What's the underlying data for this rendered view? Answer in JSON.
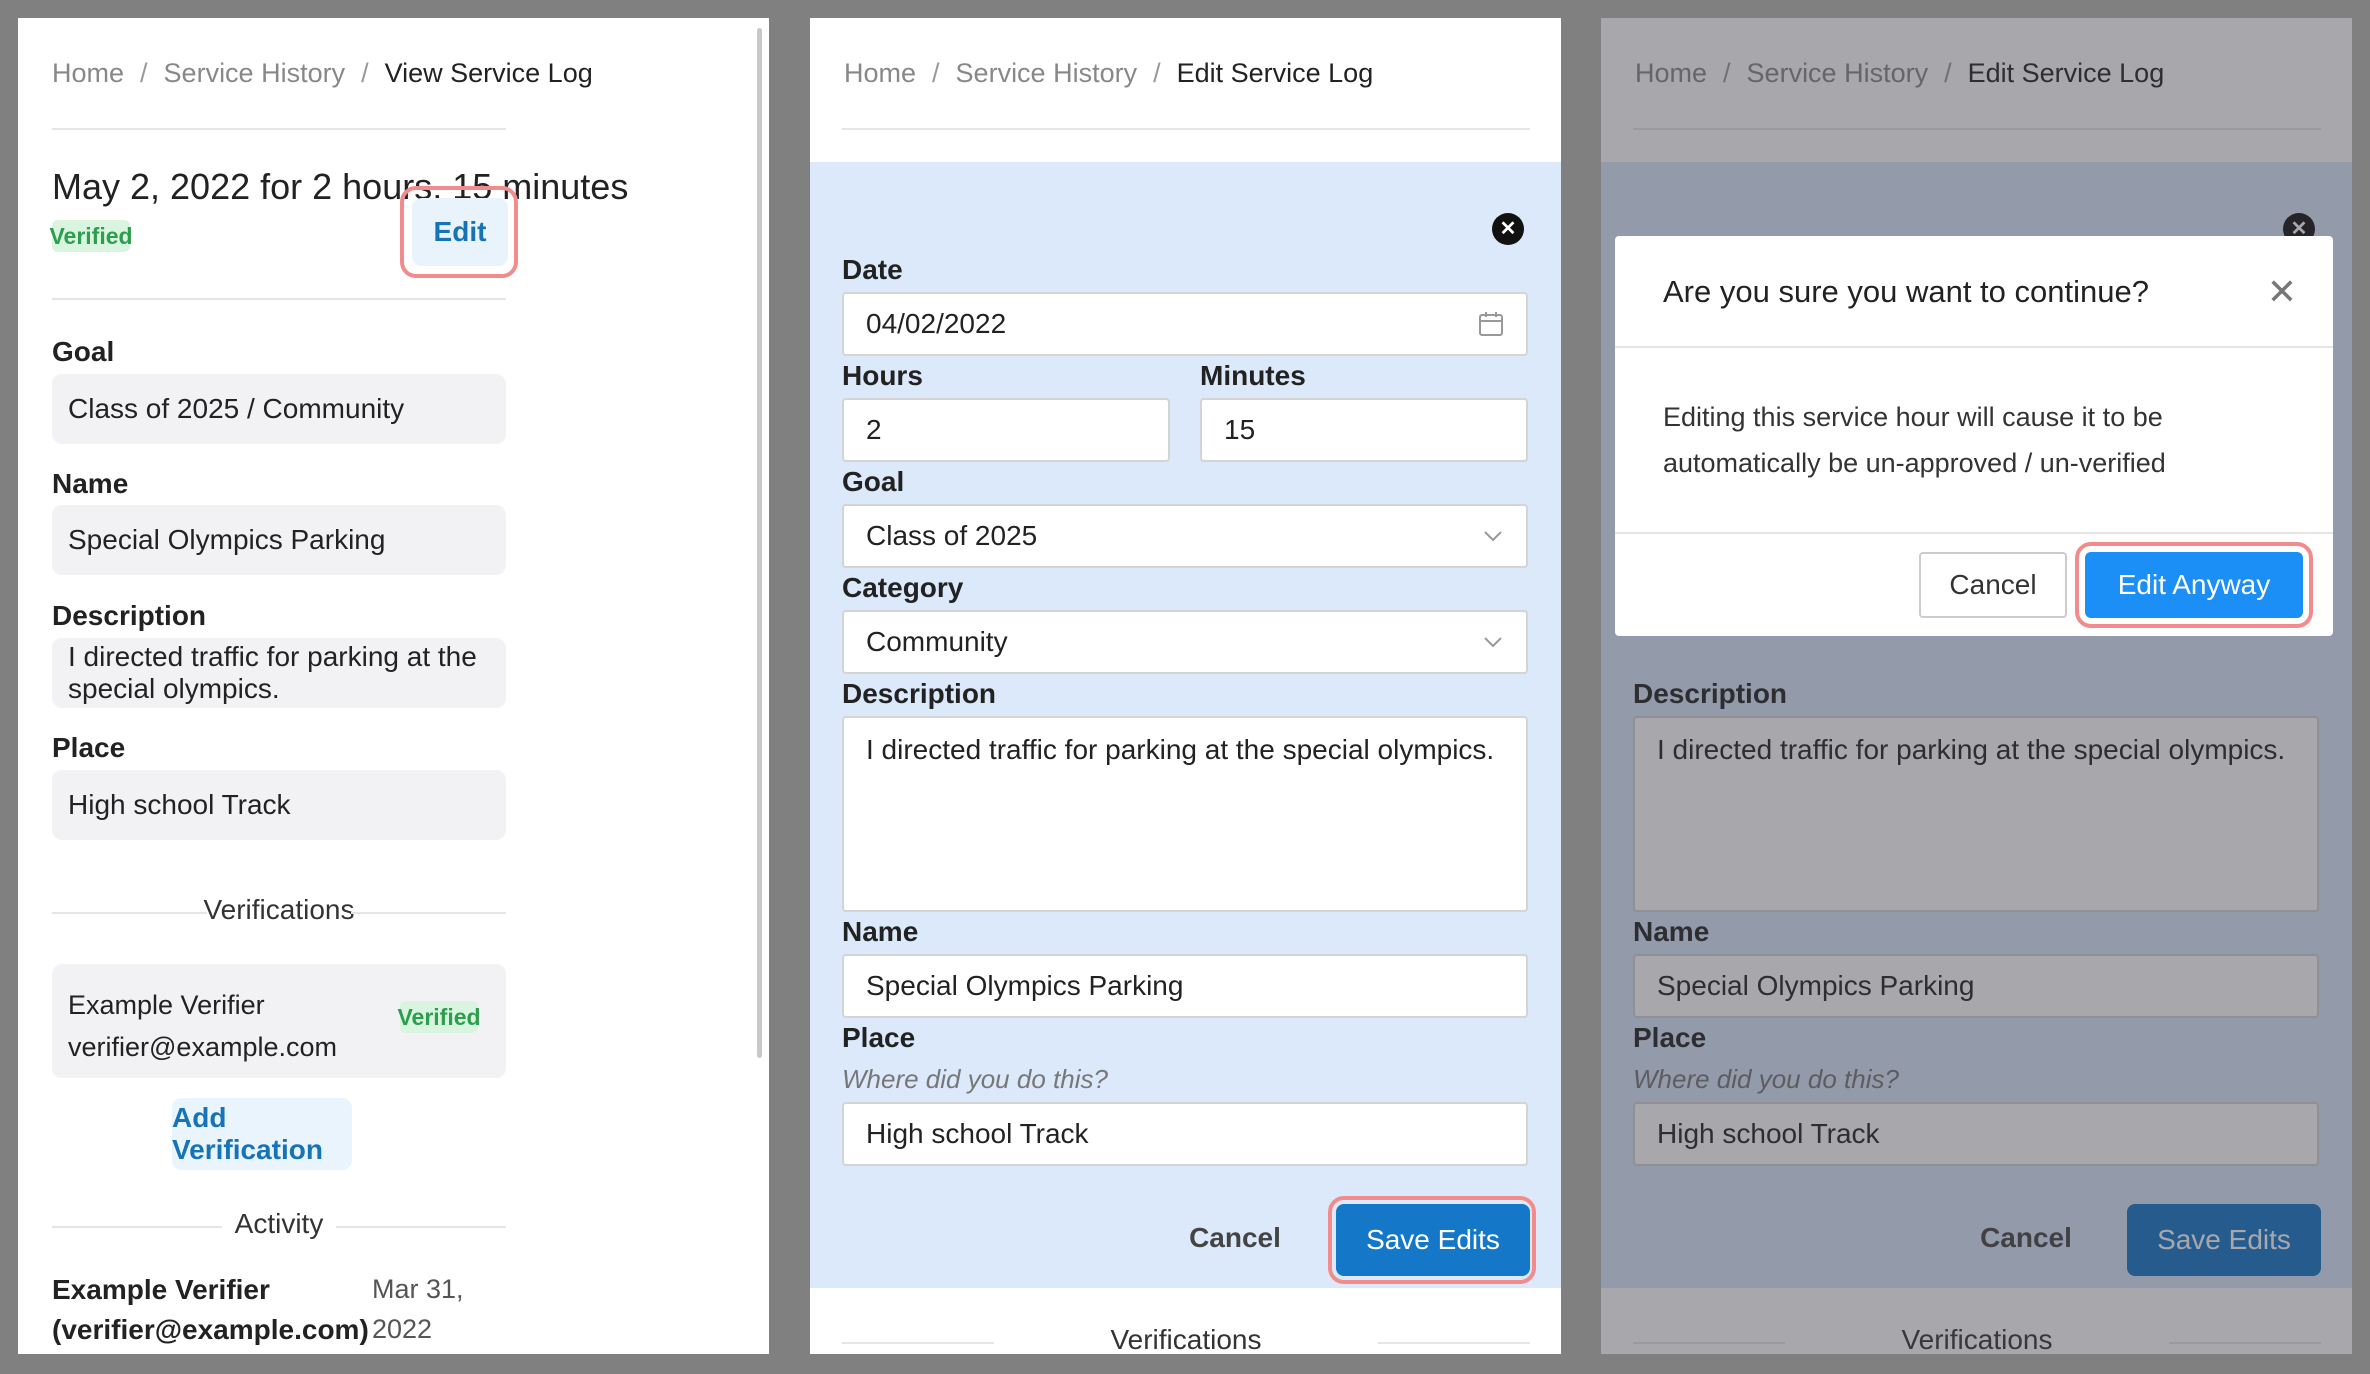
{
  "breadcrumbs": {
    "home": "Home",
    "history": "Service History",
    "view": "View Service Log",
    "edit": "Edit Service Log"
  },
  "view_log": {
    "title": "May 2, 2022 for 2 hours, 15 minutes",
    "status_badge": "Verified",
    "edit_label": "Edit",
    "goal_label": "Goal",
    "goal_value": "Class of 2025 / Community",
    "name_label": "Name",
    "name_value": "Special Olympics Parking",
    "description_label": "Description",
    "description_value": "I directed traffic for parking at the special olympics.",
    "place_label": "Place",
    "place_value": "High school Track",
    "verifications_heading": "Verifications",
    "verifier_name": "Example Verifier",
    "verifier_email": "verifier@example.com",
    "verifier_badge": "Verified",
    "add_verification_label": "Add Verification",
    "activity_heading": "Activity",
    "activity_name": "Example Verifier",
    "activity_email": "(verifier@example.com)",
    "activity_date": "Mar 31,",
    "activity_year": "2022"
  },
  "edit_form": {
    "date_label": "Date",
    "date_value": "04/02/2022",
    "hours_label": "Hours",
    "hours_value": "2",
    "minutes_label": "Minutes",
    "minutes_value": "15",
    "goal_label": "Goal",
    "goal_value": "Class of 2025",
    "category_label": "Category",
    "category_value": "Community",
    "description_label": "Description",
    "description_value": "I directed traffic for parking at the special olympics.",
    "name_label": "Name",
    "name_value": "Special Olympics Parking",
    "place_label": "Place",
    "place_hint": "Where did you do this?",
    "place_value": "High school Track",
    "cancel_label": "Cancel",
    "save_label": "Save Edits",
    "verifications_heading": "Verifications"
  },
  "confirm_dialog": {
    "title": "Are you sure you want to continue?",
    "body": "Editing this service hour will cause it to be automatically be un-approved / un-verified",
    "cancel_label": "Cancel",
    "confirm_label": "Edit Anyway"
  },
  "colors": {
    "primary": "#1577c7",
    "confirm_blue": "#1b8ff5",
    "highlight": "#f28c8c",
    "verified_bg": "#d9f5e0",
    "verified_text": "#2e9e4e",
    "form_bg": "#dbe9fb"
  },
  "icons": [
    "close-circle-icon",
    "close-icon",
    "calendar-icon",
    "chevron-down-icon"
  ]
}
